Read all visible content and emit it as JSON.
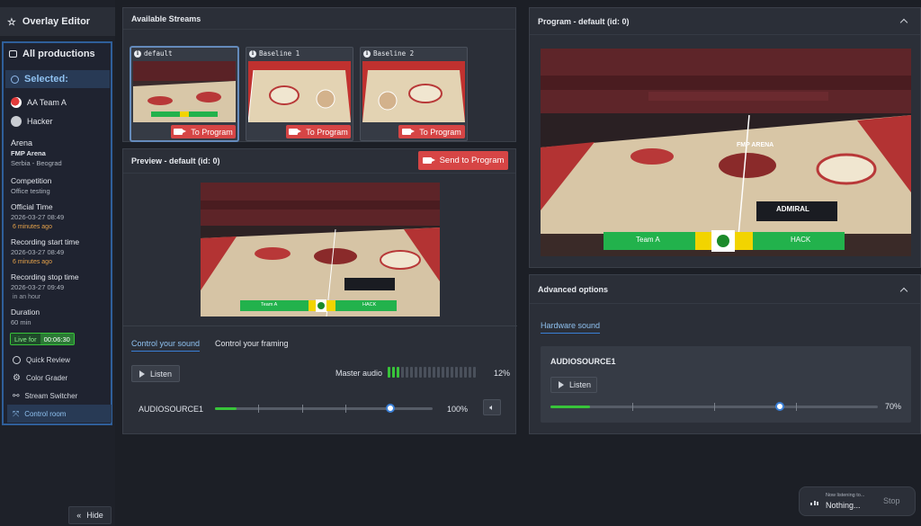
{
  "sidebar": {
    "editor_label": "Overlay Editor",
    "productions_label": "All productions",
    "selected_label": "Selected:",
    "teams": [
      "AA Team A",
      "Hacker"
    ],
    "arena_label": "Arena",
    "arena_name": "FMP Arena",
    "arena_location": "Serbia - Beograd",
    "competition_label": "Competition",
    "competition_value": "Office testing",
    "official_time_label": "Official Time",
    "official_time_value": "2026-03-27 08:49",
    "official_time_rel": "6 minutes ago",
    "rec_start_label": "Recording start time",
    "rec_start_value": "2026-03-27 08:49",
    "rec_start_rel": "6 minutes ago",
    "rec_stop_label": "Recording stop time",
    "rec_stop_value": "2026-03-27 09:49",
    "rec_stop_rel": "in an hour",
    "duration_label": "Duration",
    "duration_value": "60 min",
    "live_label": "Live for",
    "live_value": "00:06:30",
    "tools": [
      "Quick Review",
      "Color Grader",
      "Stream Switcher",
      "Control room"
    ],
    "hide_label": "Hide"
  },
  "streams": {
    "title": "Available Streams",
    "items": [
      {
        "name": "default",
        "button": "To Program"
      },
      {
        "name": "Baseline 1",
        "button": "To Program"
      },
      {
        "name": "Baseline 2",
        "button": "To Program"
      }
    ]
  },
  "preview": {
    "title": "Preview - default (id: 0)",
    "send_label": "Send to Program",
    "scoreboard_left": "Team A",
    "scoreboard_right": "HACK",
    "tabs": [
      "Control your sound",
      "Control your framing"
    ],
    "listen_label": "Listen",
    "master_label": "Master audio",
    "master_percent": "12%",
    "master_level": 0.12,
    "source_label": "AUDIOSOURCE1",
    "source_percent": "100%",
    "source_level": 1.0
  },
  "program": {
    "title": "Program - default (id: 0)",
    "arena_text": "FMP ARENA",
    "sponsor_text": "ADMIRAL",
    "scoreboard_left": "Team A",
    "scoreboard_right": "HACK"
  },
  "advanced": {
    "title": "Advanced options",
    "tab": "Hardware sound",
    "source_label": "AUDIOSOURCE1",
    "listen_label": "Listen",
    "percent": "70%",
    "level": 0.7
  },
  "listening": {
    "label": "Now listening to...",
    "value": "Nothing...",
    "stop_label": "Stop"
  },
  "colors": {
    "accent": "#3a7fd6",
    "danger": "#d64545",
    "live": "#38c43a",
    "scoreboard_green": "#22b24c",
    "scoreboard_yellow": "#f2d400"
  }
}
